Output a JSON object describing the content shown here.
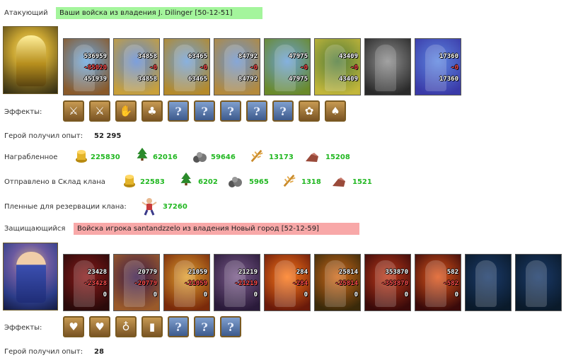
{
  "attacker": {
    "label": "Атакующий",
    "title": "Ваши войска из владения J. Dilinger [50-12-51]",
    "units": [
      {
        "icon": "knight-unit-icon",
        "top": "536959",
        "loss": "-85020",
        "bottom": "451939",
        "c1": "#6aa7e0",
        "c2": "#8a5a2a"
      },
      {
        "icon": "paladin-unit-icon",
        "top": "34858",
        "loss": "-0",
        "bottom": "34858",
        "c1": "#5f8ad6",
        "c2": "#c9a03a"
      },
      {
        "icon": "cavalier-unit-icon",
        "top": "63465",
        "loss": "-0",
        "bottom": "63465",
        "c1": "#6fa0d8",
        "c2": "#b58a2a"
      },
      {
        "icon": "griffin-unit-icon",
        "top": "84792",
        "loss": "-0",
        "bottom": "84792",
        "c1": "#6c94cf",
        "c2": "#b48a3c"
      },
      {
        "icon": "crossbowman-unit-icon",
        "top": "47975",
        "loss": "-0",
        "bottom": "47975",
        "c1": "#6aa0d8",
        "c2": "#6a8a2a"
      },
      {
        "icon": "monk-unit-icon",
        "top": "43409",
        "loss": "-0",
        "bottom": "43409",
        "c1": "#4e7a3a",
        "c2": "#c2b63a"
      },
      {
        "icon": "dark-knight-unit-icon",
        "top": "",
        "loss": "",
        "bottom": "",
        "c1": "#8e8e8e",
        "c2": "#2a2a2a"
      },
      {
        "icon": "archmage-unit-icon",
        "top": "17360",
        "loss": "-0",
        "bottom": "17360",
        "c1": "#5d86e0",
        "c2": "#3a3aa8"
      }
    ],
    "effects_label": "Эффекты:",
    "effects": [
      {
        "icon": "sword-effect-icon",
        "glyph": "⚔",
        "q": false
      },
      {
        "icon": "sword-shield-effect-icon",
        "glyph": "⚔",
        "q": false
      },
      {
        "icon": "glove-effect-icon",
        "glyph": "✋",
        "q": false
      },
      {
        "icon": "bag-effect-icon",
        "glyph": "♣",
        "q": false
      },
      {
        "icon": "unknown-effect-icon",
        "glyph": "?",
        "q": true
      },
      {
        "icon": "unknown-effect-icon",
        "glyph": "?",
        "q": true
      },
      {
        "icon": "unknown-effect-icon",
        "glyph": "?",
        "q": true
      },
      {
        "icon": "unknown-effect-icon",
        "glyph": "?",
        "q": true
      },
      {
        "icon": "unknown-effect-icon",
        "glyph": "?",
        "q": true
      },
      {
        "icon": "flower-effect-icon",
        "glyph": "✿",
        "q": false
      },
      {
        "icon": "scroll-effect-icon",
        "glyph": "♠",
        "q": false
      }
    ],
    "exp_label": "Герой получил опыт:",
    "exp_value": "52 295",
    "loot_label": "Награбленное",
    "loot": {
      "gold": "225830",
      "wood": "62016",
      "ore": "59646",
      "grain": "13173",
      "brick": "15208"
    },
    "sent_label": "Отправлено в Склад клана",
    "sent": {
      "gold": "22583",
      "wood": "6202",
      "ore": "5965",
      "grain": "1318",
      "brick": "1521"
    },
    "prisoners_label": "Пленные для резервации клана:",
    "prisoners_value": "37260"
  },
  "defender": {
    "label": "Защищающийся",
    "title": "Войска игрока santandzzelo из владения Новый город [52-12-59]",
    "units": [
      {
        "icon": "red-dragon-unit-icon",
        "top": "23428",
        "loss": "-23428",
        "bottom": "0",
        "c1": "#8a1a1a",
        "c2": "#2a0a0a"
      },
      {
        "icon": "lich-unit-icon",
        "top": "20779",
        "loss": "-20779",
        "bottom": "0",
        "c1": "#3a1a4a",
        "c2": "#9a5a2a"
      },
      {
        "icon": "fire-beast-unit-icon",
        "top": "21059",
        "loss": "-21059",
        "bottom": "0",
        "c1": "#e0a030",
        "c2": "#7a2a0a"
      },
      {
        "icon": "gargoyle-unit-icon",
        "top": "21219",
        "loss": "-21219",
        "bottom": "0",
        "c1": "#7a5a8a",
        "c2": "#2a1a3a"
      },
      {
        "icon": "fire-elemental-unit-icon",
        "top": "284",
        "loss": "-284",
        "bottom": "0",
        "c1": "#ff7a1a",
        "c2": "#6a1a0a"
      },
      {
        "icon": "ogre-unit-icon",
        "top": "25814",
        "loss": "-25814",
        "bottom": "0",
        "c1": "#d06a1a",
        "c2": "#3a2a0a"
      },
      {
        "icon": "demon-lord-unit-icon",
        "top": "353870",
        "loss": "-353870",
        "bottom": "0",
        "c1": "#c03a1a",
        "c2": "#3a0a0a"
      },
      {
        "icon": "reaper-unit-icon",
        "top": "582",
        "loss": "-582",
        "bottom": "0",
        "c1": "#e0561a",
        "c2": "#3a0a0a"
      },
      {
        "icon": "war-machine-unit-icon",
        "top": "",
        "loss": "",
        "bottom": "",
        "c1": "#1a3a6a",
        "c2": "#0a1a2a"
      },
      {
        "icon": "war-machine-unit-icon",
        "top": "",
        "loss": "",
        "bottom": "",
        "c1": "#1a3a6a",
        "c2": "#0a1a2a"
      }
    ],
    "effects_label": "Эффекты:",
    "effects": [
      {
        "icon": "heart-effect-icon",
        "glyph": "♥",
        "q": false
      },
      {
        "icon": "heart-sword-effect-icon",
        "glyph": "♥",
        "q": false
      },
      {
        "icon": "potion-effect-icon",
        "glyph": "♁",
        "q": false
      },
      {
        "icon": "door-effect-icon",
        "glyph": "▮",
        "q": false
      },
      {
        "icon": "unknown-effect-icon",
        "glyph": "?",
        "q": true
      },
      {
        "icon": "unknown-effect-icon",
        "glyph": "?",
        "q": true
      },
      {
        "icon": "unknown-effect-icon",
        "glyph": "?",
        "q": true
      }
    ],
    "exp_label": "Герой получил опыт:",
    "exp_value": "28"
  }
}
